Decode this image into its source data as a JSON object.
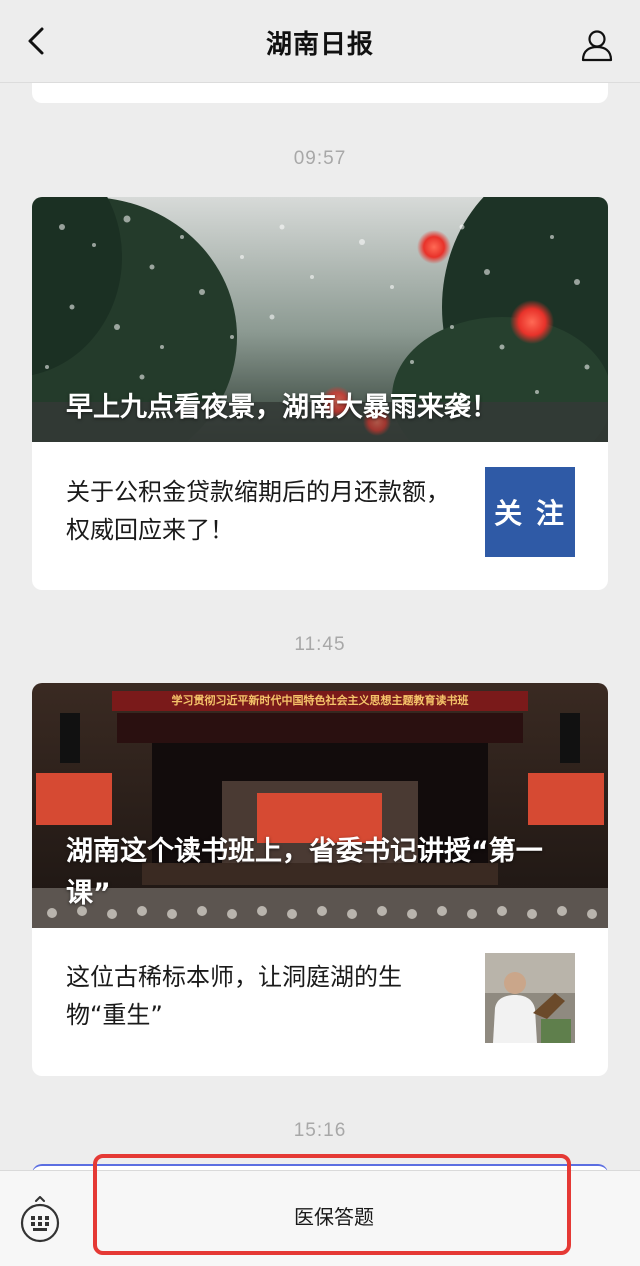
{
  "header": {
    "title": "湖南日报"
  },
  "timeline": [
    {
      "time": "09:57",
      "hero_title": "早上九点看夜景，湖南大暴雨来袭！",
      "sub_title": "关于公积金贷款缩期后的月还款额，权威回应来了！",
      "thumb_text": "关 注"
    },
    {
      "time": "11:45",
      "hero_title": "湖南这个读书班上，省委书记讲授“第一课”",
      "banner_text": "学习贯彻习近平新时代中国特色社会主义思想主题教育读书班",
      "sub_title": "这位古稀标本师，让洞庭湖的生物“重生”"
    },
    {
      "time": "15:16"
    }
  ],
  "bottom_menu": {
    "item_label": "医保答题"
  },
  "colors": {
    "background": "#ededed",
    "highlight": "#e53935",
    "follow_thumb": "#2f5aa6"
  }
}
